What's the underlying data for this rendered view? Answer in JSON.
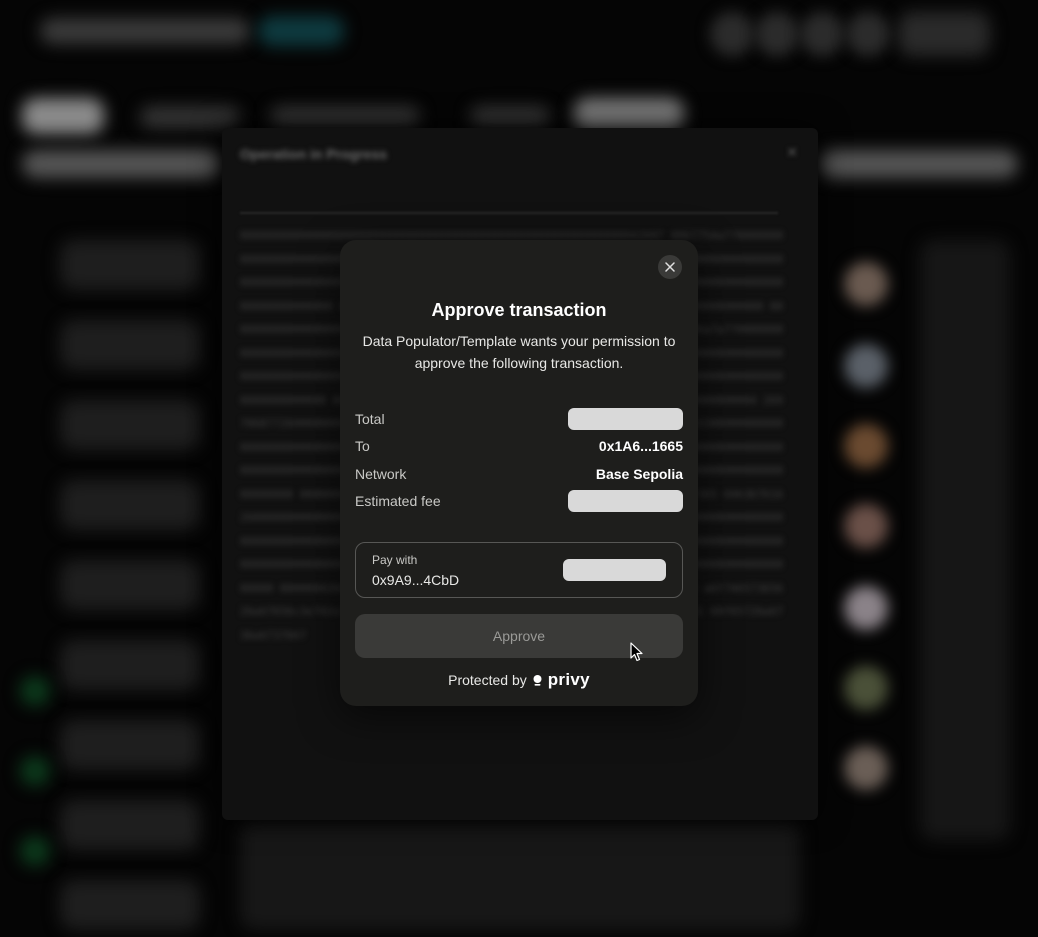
{
  "background": {
    "operation_modal": {
      "title": "Operation in Progress",
      "hex_payload": "0000000000000000000000000000000000000000000000000000000000042687 0867754a77000000000000000000000000000000000000000000000003e70708 9667a4f00000000000000000000000000000000000000000000000000df4e1616 862667a400000000000000000000000000000000000000000000000000000000 0000000000000000000000000000000000000000000000000000000000000000 0000000000000000000000000000000000000000000000000000000fa69ae676 30a0f46a7a770000000000000000000000000000000000000000000022b68676 40879b771700000000000000000000000000000000000000000000000000000000 0000000000000000000000000000000000000000000000000000000000000000 0000000000000000000000000000000000000000000000000000000000000004 2697068772600000000000000000000000000000000000000000000717060327 6357673338000000000000000000000000000000000000000000006770e637 6376027468000000000000000000000000000000000000000000000000000000 0000000000000000000000000000000000000000000000000000000000000000 000000000000000000000000000000000000000000000000000000f6e6d7365 69636761626000000000000000000000000000000000000000000007d6e5666 6274e6e6e600000000000000000000000000000000000000000000000000000000 0000000000000000000000000000000000000000000000000000000000000000 0000000000000000000000000000000000000000000000000000000000000000 0000004266700000000000000000000000000000000000000000008c736c716 a6f74657365626e67656c3e742e3c3467320736530e5736f672c6468 3 3 a 2 5 d 3 3 1 8 46c61 69f65726e6736e6737667"
    }
  },
  "dialog": {
    "title": "Approve transaction",
    "subtitle": "Data Populator/Template wants your permission to approve the following transaction.",
    "rows": [
      {
        "label": "Total",
        "value": null
      },
      {
        "label": "To",
        "value": "0x1A6...1665"
      },
      {
        "label": "Network",
        "value": "Base Sepolia"
      },
      {
        "label": "Estimated fee",
        "value": null
      }
    ],
    "pay_with": {
      "label": "Pay with",
      "address": "0x9A9...4CbD"
    },
    "approve_label": "Approve",
    "protected_by": "Protected by",
    "brand": "privy"
  },
  "colors": {
    "dialog_bg": "#1e1e1c",
    "button_bg": "#3a3a38",
    "skeleton": "#d9d9d9"
  },
  "icons": [
    "close-icon",
    "privy-logo-icon",
    "pointer-cursor-icon"
  ]
}
